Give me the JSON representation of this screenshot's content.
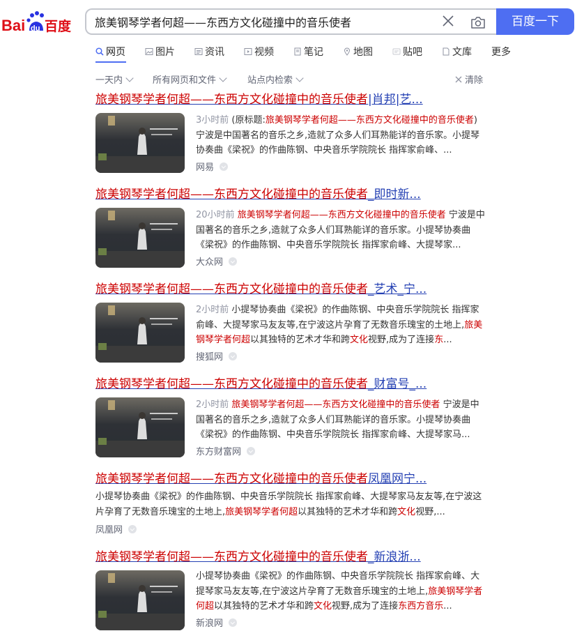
{
  "logo": {
    "text_left": "Bai",
    "text_paw": "du",
    "text_right": "百度"
  },
  "search": {
    "query": "旅美钢琴学者何超——东西方文化碰撞中的音乐使者",
    "button": "百度一下"
  },
  "tabs": [
    {
      "label": "网页"
    },
    {
      "label": "图片"
    },
    {
      "label": "资讯"
    },
    {
      "label": "视频"
    },
    {
      "label": "笔记"
    },
    {
      "label": "地图"
    },
    {
      "label": "贴吧"
    },
    {
      "label": "文库"
    },
    {
      "label": "更多"
    }
  ],
  "filters": {
    "time": "一天内",
    "type": "所有网页和文件",
    "site": "站点内检索",
    "clear": "清除"
  },
  "results": [
    {
      "title_hl": "旅美钢琴学者何超——东西方文化碰撞中的音乐使者",
      "title_rest": "|肖邦|艺...",
      "time": "3小时前",
      "orig_prefix": "(原标题:",
      "orig_title": "旅美钢琴学者何超——东西方文化碰撞中的音乐使者",
      "orig_suffix": ")",
      "snippet": "宁波是中国著名的音乐之乡,造就了众多人们耳熟能详的音乐家。小提琴协奏曲《梁祝》的作曲陈钢、中央音乐学院院长 指挥家俞峰、...",
      "source": "网易"
    },
    {
      "title_hl": "旅美钢琴学者何超——东西方文化碰撞中的音乐使者",
      "title_rest": "_即时新...",
      "time": "20小时前",
      "inline_title": "旅美钢琴学者何超——东西方文化碰撞中的音乐使者",
      "snippet": "宁波是中国著名的音乐之乡,造就了众多人们耳熟能详的音乐家。小提琴协奏曲《梁祝》的作曲陈钢、中央音乐学院院长 指挥家俞峰、大提琴家...",
      "source": "大众网"
    },
    {
      "title_hl": "旅美钢琴学者何超——东西方文化碰撞中的音乐使者",
      "title_rest": "_艺术_宁...",
      "time": "2小时前",
      "snippet_a": "小提琴协奏曲《梁祝》的作曲陈钢、中央音乐学院院长 指挥家俞峰、大提琴家马友友等,在宁波这片孕育了无数音乐瑰宝的土地上,",
      "snippet_hl1": "旅美钢琴学者何超",
      "snippet_b": "以其独特的艺术才华和跨",
      "snippet_hl2": "文化",
      "snippet_c": "视野,成为了连接",
      "snippet_hl3": "东",
      "snippet_end": "...",
      "source": "搜狐网"
    },
    {
      "title_hl": "旅美钢琴学者何超——东西方文化碰撞中的音乐使者",
      "title_rest": "_财富号_...",
      "time": "2小时前",
      "inline_title": "旅美钢琴学者何超——东西方文化碰撞中的音乐使者",
      "snippet": "宁波是中国著名的音乐之乡,造就了众多人们耳熟能详的音乐家。小提琴协奏曲《梁祝》的作曲陈钢、中央音乐学院院长 指挥家俞峰、大提琴家马...",
      "source": "东方财富网"
    },
    {
      "title_hl": "旅美钢琴学者何超——东西方文化碰撞中的音乐使者",
      "title_rest": "凤凰网宁...",
      "snippet_a": "小提琴协奏曲《梁祝》的作曲陈钢、中央音乐学院院长 指挥家俞峰、大提琴家马友友等,在宁波这片孕育了无数音乐瑰宝的土地上,",
      "snippet_hl1": "旅美钢琴学者何超",
      "snippet_b": "以其独特的艺术才华和跨",
      "snippet_hl2": "文化",
      "snippet_c": "视野,...",
      "source": "凤凰网"
    },
    {
      "title_hl": "旅美钢琴学者何超——东西方文化碰撞中的音乐使者",
      "title_rest": "_新浪浙...",
      "snippet_a": "小提琴协奏曲《梁祝》的作曲陈钢、中央音乐学院院长 指挥家俞峰、大提琴家马友友等,在宁波这片孕育了无数音乐瑰宝的土地上,",
      "snippet_hl1": "旅美钢琴学者何超",
      "snippet_b": "以其独特的艺术才华和跨",
      "snippet_hl2": "文化",
      "snippet_c": "视野,成为了连接",
      "snippet_hl3": "东西方音乐",
      "snippet_end": "...",
      "source": "新浪网"
    }
  ],
  "colors": {
    "brand_blue": "#4e6ef2",
    "logo_red": "#de0f17",
    "logo_blue": "#2932e1",
    "link": "#2440b3",
    "highlight": "#cc0000"
  }
}
